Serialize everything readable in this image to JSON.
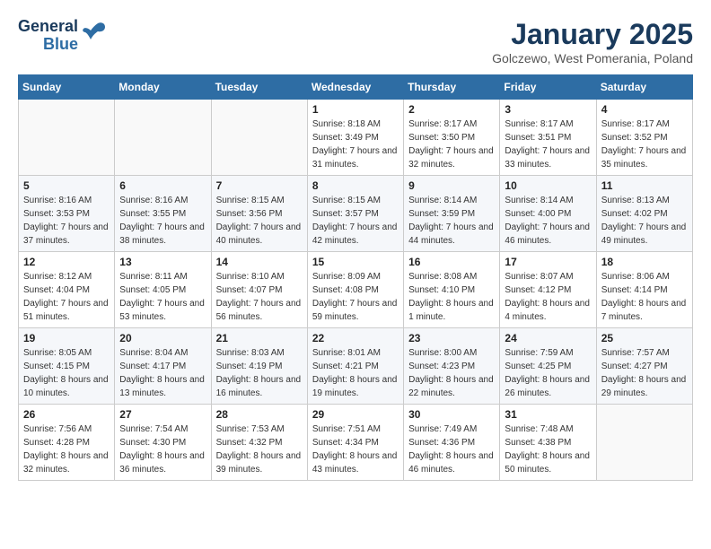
{
  "header": {
    "logo_general": "General",
    "logo_blue": "Blue",
    "title": "January 2025",
    "subtitle": "Golczewo, West Pomerania, Poland"
  },
  "weekdays": [
    "Sunday",
    "Monday",
    "Tuesday",
    "Wednesday",
    "Thursday",
    "Friday",
    "Saturday"
  ],
  "weeks": [
    [
      {
        "day": "",
        "sunrise": "",
        "sunset": "",
        "daylight": ""
      },
      {
        "day": "",
        "sunrise": "",
        "sunset": "",
        "daylight": ""
      },
      {
        "day": "",
        "sunrise": "",
        "sunset": "",
        "daylight": ""
      },
      {
        "day": "1",
        "sunrise": "Sunrise: 8:18 AM",
        "sunset": "Sunset: 3:49 PM",
        "daylight": "Daylight: 7 hours and 31 minutes."
      },
      {
        "day": "2",
        "sunrise": "Sunrise: 8:17 AM",
        "sunset": "Sunset: 3:50 PM",
        "daylight": "Daylight: 7 hours and 32 minutes."
      },
      {
        "day": "3",
        "sunrise": "Sunrise: 8:17 AM",
        "sunset": "Sunset: 3:51 PM",
        "daylight": "Daylight: 7 hours and 33 minutes."
      },
      {
        "day": "4",
        "sunrise": "Sunrise: 8:17 AM",
        "sunset": "Sunset: 3:52 PM",
        "daylight": "Daylight: 7 hours and 35 minutes."
      }
    ],
    [
      {
        "day": "5",
        "sunrise": "Sunrise: 8:16 AM",
        "sunset": "Sunset: 3:53 PM",
        "daylight": "Daylight: 7 hours and 37 minutes."
      },
      {
        "day": "6",
        "sunrise": "Sunrise: 8:16 AM",
        "sunset": "Sunset: 3:55 PM",
        "daylight": "Daylight: 7 hours and 38 minutes."
      },
      {
        "day": "7",
        "sunrise": "Sunrise: 8:15 AM",
        "sunset": "Sunset: 3:56 PM",
        "daylight": "Daylight: 7 hours and 40 minutes."
      },
      {
        "day": "8",
        "sunrise": "Sunrise: 8:15 AM",
        "sunset": "Sunset: 3:57 PM",
        "daylight": "Daylight: 7 hours and 42 minutes."
      },
      {
        "day": "9",
        "sunrise": "Sunrise: 8:14 AM",
        "sunset": "Sunset: 3:59 PM",
        "daylight": "Daylight: 7 hours and 44 minutes."
      },
      {
        "day": "10",
        "sunrise": "Sunrise: 8:14 AM",
        "sunset": "Sunset: 4:00 PM",
        "daylight": "Daylight: 7 hours and 46 minutes."
      },
      {
        "day": "11",
        "sunrise": "Sunrise: 8:13 AM",
        "sunset": "Sunset: 4:02 PM",
        "daylight": "Daylight: 7 hours and 49 minutes."
      }
    ],
    [
      {
        "day": "12",
        "sunrise": "Sunrise: 8:12 AM",
        "sunset": "Sunset: 4:04 PM",
        "daylight": "Daylight: 7 hours and 51 minutes."
      },
      {
        "day": "13",
        "sunrise": "Sunrise: 8:11 AM",
        "sunset": "Sunset: 4:05 PM",
        "daylight": "Daylight: 7 hours and 53 minutes."
      },
      {
        "day": "14",
        "sunrise": "Sunrise: 8:10 AM",
        "sunset": "Sunset: 4:07 PM",
        "daylight": "Daylight: 7 hours and 56 minutes."
      },
      {
        "day": "15",
        "sunrise": "Sunrise: 8:09 AM",
        "sunset": "Sunset: 4:08 PM",
        "daylight": "Daylight: 7 hours and 59 minutes."
      },
      {
        "day": "16",
        "sunrise": "Sunrise: 8:08 AM",
        "sunset": "Sunset: 4:10 PM",
        "daylight": "Daylight: 8 hours and 1 minute."
      },
      {
        "day": "17",
        "sunrise": "Sunrise: 8:07 AM",
        "sunset": "Sunset: 4:12 PM",
        "daylight": "Daylight: 8 hours and 4 minutes."
      },
      {
        "day": "18",
        "sunrise": "Sunrise: 8:06 AM",
        "sunset": "Sunset: 4:14 PM",
        "daylight": "Daylight: 8 hours and 7 minutes."
      }
    ],
    [
      {
        "day": "19",
        "sunrise": "Sunrise: 8:05 AM",
        "sunset": "Sunset: 4:15 PM",
        "daylight": "Daylight: 8 hours and 10 minutes."
      },
      {
        "day": "20",
        "sunrise": "Sunrise: 8:04 AM",
        "sunset": "Sunset: 4:17 PM",
        "daylight": "Daylight: 8 hours and 13 minutes."
      },
      {
        "day": "21",
        "sunrise": "Sunrise: 8:03 AM",
        "sunset": "Sunset: 4:19 PM",
        "daylight": "Daylight: 8 hours and 16 minutes."
      },
      {
        "day": "22",
        "sunrise": "Sunrise: 8:01 AM",
        "sunset": "Sunset: 4:21 PM",
        "daylight": "Daylight: 8 hours and 19 minutes."
      },
      {
        "day": "23",
        "sunrise": "Sunrise: 8:00 AM",
        "sunset": "Sunset: 4:23 PM",
        "daylight": "Daylight: 8 hours and 22 minutes."
      },
      {
        "day": "24",
        "sunrise": "Sunrise: 7:59 AM",
        "sunset": "Sunset: 4:25 PM",
        "daylight": "Daylight: 8 hours and 26 minutes."
      },
      {
        "day": "25",
        "sunrise": "Sunrise: 7:57 AM",
        "sunset": "Sunset: 4:27 PM",
        "daylight": "Daylight: 8 hours and 29 minutes."
      }
    ],
    [
      {
        "day": "26",
        "sunrise": "Sunrise: 7:56 AM",
        "sunset": "Sunset: 4:28 PM",
        "daylight": "Daylight: 8 hours and 32 minutes."
      },
      {
        "day": "27",
        "sunrise": "Sunrise: 7:54 AM",
        "sunset": "Sunset: 4:30 PM",
        "daylight": "Daylight: 8 hours and 36 minutes."
      },
      {
        "day": "28",
        "sunrise": "Sunrise: 7:53 AM",
        "sunset": "Sunset: 4:32 PM",
        "daylight": "Daylight: 8 hours and 39 minutes."
      },
      {
        "day": "29",
        "sunrise": "Sunrise: 7:51 AM",
        "sunset": "Sunset: 4:34 PM",
        "daylight": "Daylight: 8 hours and 43 minutes."
      },
      {
        "day": "30",
        "sunrise": "Sunrise: 7:49 AM",
        "sunset": "Sunset: 4:36 PM",
        "daylight": "Daylight: 8 hours and 46 minutes."
      },
      {
        "day": "31",
        "sunrise": "Sunrise: 7:48 AM",
        "sunset": "Sunset: 4:38 PM",
        "daylight": "Daylight: 8 hours and 50 minutes."
      },
      {
        "day": "",
        "sunrise": "",
        "sunset": "",
        "daylight": ""
      }
    ]
  ]
}
